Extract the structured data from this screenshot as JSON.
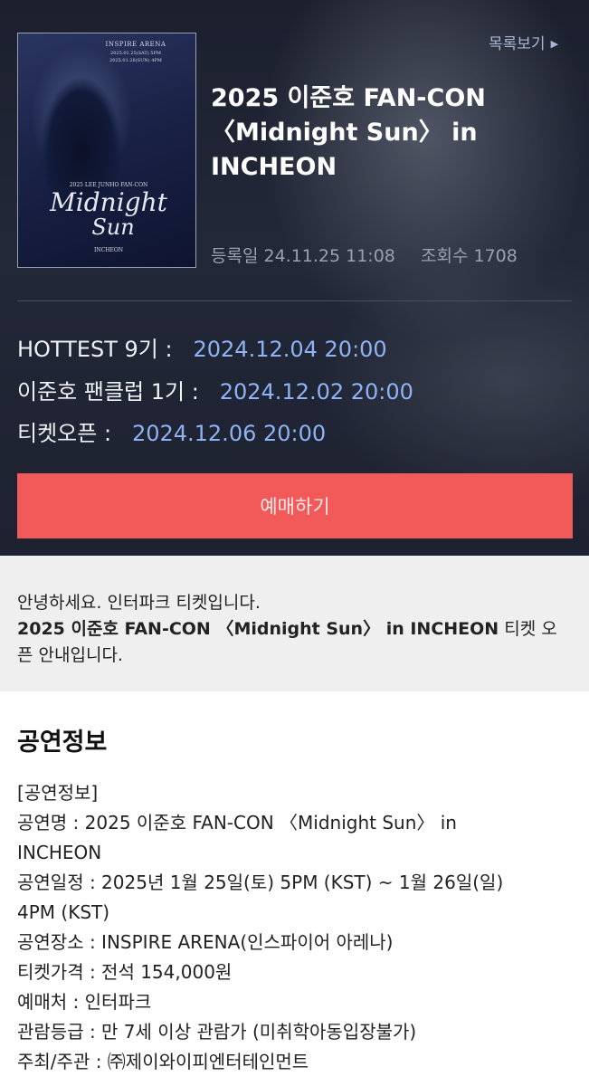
{
  "poster": {
    "arena": "INSPIRE ARENA",
    "dates_line1": "2025.01.25(SAT) 5PM",
    "dates_line2": "2025.01.26(SUN) 4PM",
    "fancon": "2025 LEE JUNHO FAN-CON",
    "title_line1": "Midnight",
    "title_line2": "Sun",
    "city": "INCHEON"
  },
  "header": {
    "list_link": "목록보기",
    "title": "2025 이준호 FAN-CON\n〈Midnight Sun〉 in\nINCHEON",
    "registered": "등록일 24.11.25 11:08",
    "views": "조회수 1708"
  },
  "schedule": [
    {
      "label": "HOTTEST 9기 :",
      "value": "2024.12.04 20:00"
    },
    {
      "label": "이준호 팬클럽 1기 :",
      "value": "2024.12.02 20:00"
    },
    {
      "label": "티켓오픈 :",
      "value": "2024.12.06 20:00"
    }
  ],
  "book_button": "예매하기",
  "notice": {
    "line1": "안녕하세요. 인터파크 티켓입니다.",
    "bold": "2025 이준호 FAN-CON 〈Midnight Sun〉 in INCHEON",
    "rest": " 티켓 오픈 안내입니다."
  },
  "info": {
    "heading": "공연정보",
    "lines": [
      "[공연정보]",
      "공연명 : 2025 이준호 FAN-CON 〈Midnight Sun〉 in\nINCHEON",
      "공연일정 : 2025년 1월 25일(토) 5PM (KST) ~ 1월 26일(일)\n4PM (KST)",
      "공연장소 : INSPIRE ARENA(인스파이어 아레나)",
      "티켓가격 : 전석 154,000원",
      "예매처 : 인터파크",
      "관람등급 : 만 7세 이상 관람가 (미취학아동입장불가)",
      "주최/주관 : ㈜제이와이피엔터테인먼트"
    ]
  },
  "colors": {
    "accent_button": "#f25a5a",
    "date_blue": "#8fb3f5",
    "link": "#a9b6d6"
  }
}
